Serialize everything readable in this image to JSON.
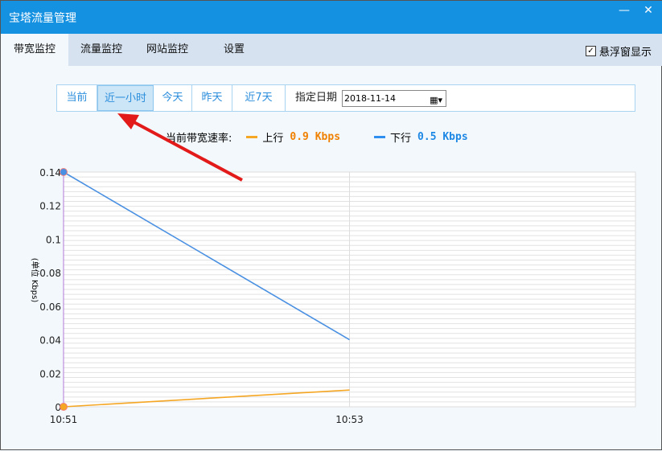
{
  "window": {
    "title": "宝塔流量管理",
    "minimize": "—",
    "close": "✕"
  },
  "tabs": [
    {
      "label": "带宽监控"
    },
    {
      "label": "流量监控"
    },
    {
      "label": "网站监控"
    },
    {
      "label": "设置"
    }
  ],
  "float_display": {
    "label": "悬浮窗显示",
    "checked": true
  },
  "range_buttons": [
    {
      "label": "当前"
    },
    {
      "label": "近一小时"
    },
    {
      "label": "今天"
    },
    {
      "label": "昨天"
    },
    {
      "label": "近7天"
    }
  ],
  "date_picker": {
    "label": "指定日期",
    "value": "2018-11-14"
  },
  "legend": {
    "title": "当前带宽速率:",
    "up_label": "上行",
    "up_value": "0.9 Kbps",
    "down_label": "下行",
    "down_value": "0.5 Kbps"
  },
  "colors": {
    "up": "#f5a623",
    "down": "#4a90e2",
    "up_text": "#f08000",
    "down_text": "#1e88e5"
  },
  "chart_data": {
    "type": "line",
    "x": [
      "10:51",
      "10:53"
    ],
    "xrange": [
      0,
      2
    ],
    "ylim": [
      0,
      0.14
    ],
    "ylabel": "(单位 Kbps)",
    "yticks": [
      "0",
      "0.02",
      "0.04",
      "0.06",
      "0.08",
      "0.1",
      "0.12",
      "0.14"
    ],
    "series": [
      {
        "name": "下行",
        "values": [
          0.14,
          0.04
        ]
      },
      {
        "name": "上行",
        "values": [
          0,
          0.01
        ]
      }
    ]
  }
}
